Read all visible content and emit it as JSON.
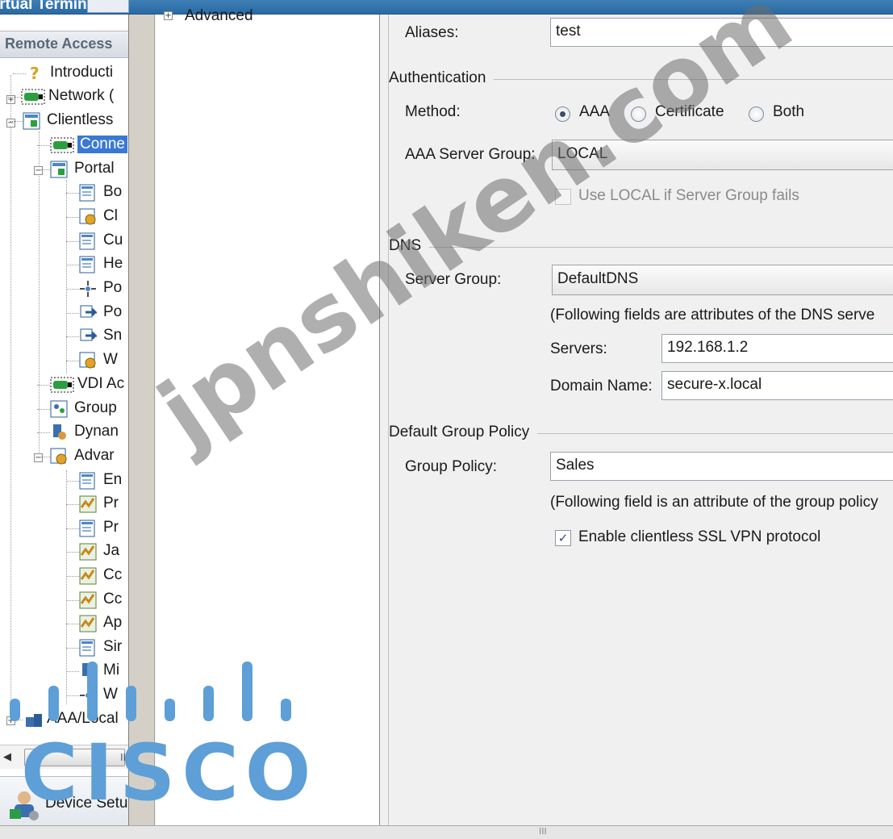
{
  "window": {
    "title": "irtual Terminal"
  },
  "nav": {
    "header": "Remote Access",
    "items": [
      {
        "label": "Introducti"
      },
      {
        "label": "Network ("
      },
      {
        "label": "Clientless"
      },
      {
        "label": "Conne"
      },
      {
        "label": "Portal"
      },
      {
        "label": "Bo"
      },
      {
        "label": "Cl"
      },
      {
        "label": "Cu"
      },
      {
        "label": "He"
      },
      {
        "label": "Po"
      },
      {
        "label": "Po"
      },
      {
        "label": "Sn"
      },
      {
        "label": "W"
      },
      {
        "label": "VDI Ac"
      },
      {
        "label": "Group"
      },
      {
        "label": "Dynan"
      },
      {
        "label": "Advar"
      },
      {
        "label": "En"
      },
      {
        "label": "Pr"
      },
      {
        "label": "Pr"
      },
      {
        "label": "Ja"
      },
      {
        "label": "Cc"
      },
      {
        "label": "Cc"
      },
      {
        "label": "Ap"
      },
      {
        "label": "Sir"
      },
      {
        "label": "Mi"
      },
      {
        "label": "W"
      },
      {
        "label": "AAA/Local"
      }
    ],
    "device_setup": "Device Setu"
  },
  "scrollbar": {
    "thumb_grip": "III"
  },
  "list": {
    "advanced_label": "Advanced"
  },
  "form": {
    "aliases_label": "Aliases:",
    "aliases_value": "test",
    "auth_section": "Authentication",
    "method_label": "Method:",
    "method_options": [
      "AAA",
      "Certificate",
      "Both"
    ],
    "method_selected": "AAA",
    "aaa_group_label": "AAA Server Group:",
    "aaa_group_value": "LOCAL",
    "use_local_label": "Use LOCAL if Server Group fails",
    "use_local_checked": false,
    "dns_section": "DNS",
    "server_group_label": "Server Group:",
    "server_group_value": "DefaultDNS",
    "dns_note": "(Following fields are attributes of the DNS serve",
    "servers_label": "Servers:",
    "servers_value": "192.168.1.2",
    "domain_label": "Domain Name:",
    "domain_value": "secure-x.local",
    "dgp_section": "Default Group Policy",
    "group_policy_label": "Group Policy:",
    "group_policy_value": "Sales",
    "gp_note": "(Following field is an attribute of the group policy",
    "enable_ssl_label": "Enable clientless SSL VPN protocol",
    "enable_ssl_checked": true
  },
  "watermark": {
    "text": "jpnshiken.com",
    "logo_text": "CISCO"
  },
  "status": {
    "grip": "III"
  },
  "colors": {
    "accent": "#3a78d6",
    "cisco_blue": "#5d9fd6",
    "titlebar": "#2a6aa3"
  }
}
